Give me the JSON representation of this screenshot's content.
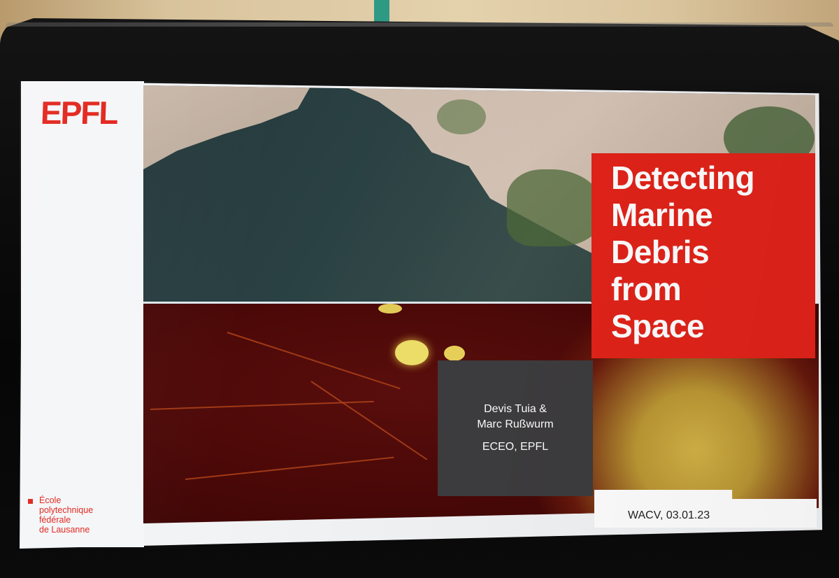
{
  "slide": {
    "logo": "EPFL",
    "institution": "École\npolytechnique\nfédérale\nde Lausanne",
    "title": "Detecting\nMarine\nDebris\nfrom\nSpace",
    "authors": "Devis Tuia &\nMarc Rußwurm",
    "affiliation": "ECEO, EPFL",
    "footer": "WACV, 03.01.23"
  },
  "colors": {
    "brand_red": "#e2231a",
    "author_box": "#3d3c3e",
    "heatmap_dark": "#4a0807",
    "heatmap_hot": "#efe06a"
  },
  "images": {
    "top": "satellite-rgb-coastline",
    "bottom": "marine-debris-probability-heatmap"
  }
}
